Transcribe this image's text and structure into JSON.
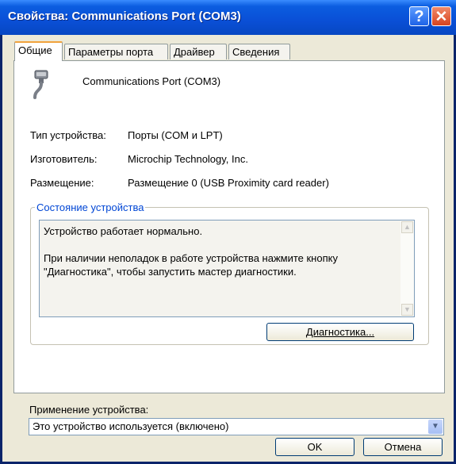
{
  "window": {
    "title": "Свойства: Communications Port (COM3)",
    "help_glyph": "?",
    "close_glyph": "✕"
  },
  "tabs": [
    {
      "label": "Общие",
      "active": true
    },
    {
      "label": "Параметры порта"
    },
    {
      "label": "Драйвер"
    },
    {
      "label": "Сведения"
    }
  ],
  "device": {
    "icon": "serial-port-icon",
    "name": "Communications Port (COM3)"
  },
  "properties": [
    {
      "label": "Тип устройства:",
      "value": "Порты (COM и LPT)"
    },
    {
      "label": "Изготовитель:",
      "value": "Microchip Technology, Inc."
    },
    {
      "label": "Размещение:",
      "value": "Размещение 0 (USB Proximity card reader)"
    }
  ],
  "status_group": {
    "legend": "Состояние устройства",
    "line1": "Устройство работает нормально.",
    "line2": "При наличии неполадок в работе устройства нажмите кнопку \"Диагностика\", чтобы запустить мастер диагностики.",
    "diagnostics_button": "Диагностика..."
  },
  "usage": {
    "label": "Применение устройства:",
    "selected": "Это устройство используется (включено)"
  },
  "buttons": {
    "ok": "OK",
    "cancel": "Отмена"
  }
}
